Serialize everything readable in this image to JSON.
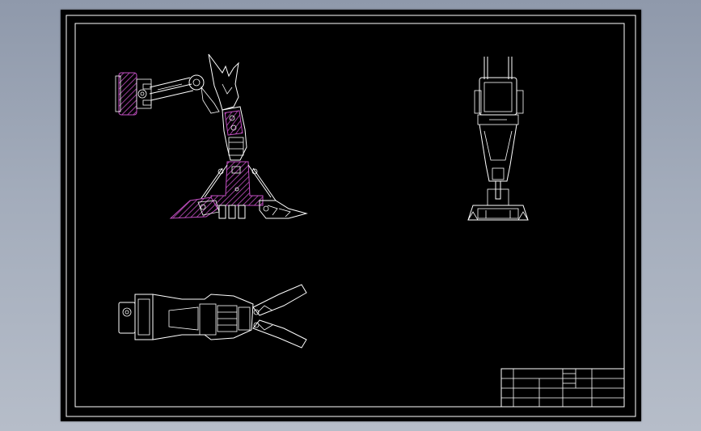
{
  "drawing": {
    "background_color": "#000000",
    "line_color": "#ffffff",
    "hatch_color": "#c34fc3",
    "viewport_background": "#9aa3b3"
  },
  "title_block": {
    "cells": {
      "r1c1": "",
      "r2c1": "",
      "r3c1": "",
      "r4c1": "",
      "top_a": "",
      "top_b": "",
      "mid_a": "",
      "mid_b": "",
      "mid_c": "",
      "right_a": ""
    }
  }
}
